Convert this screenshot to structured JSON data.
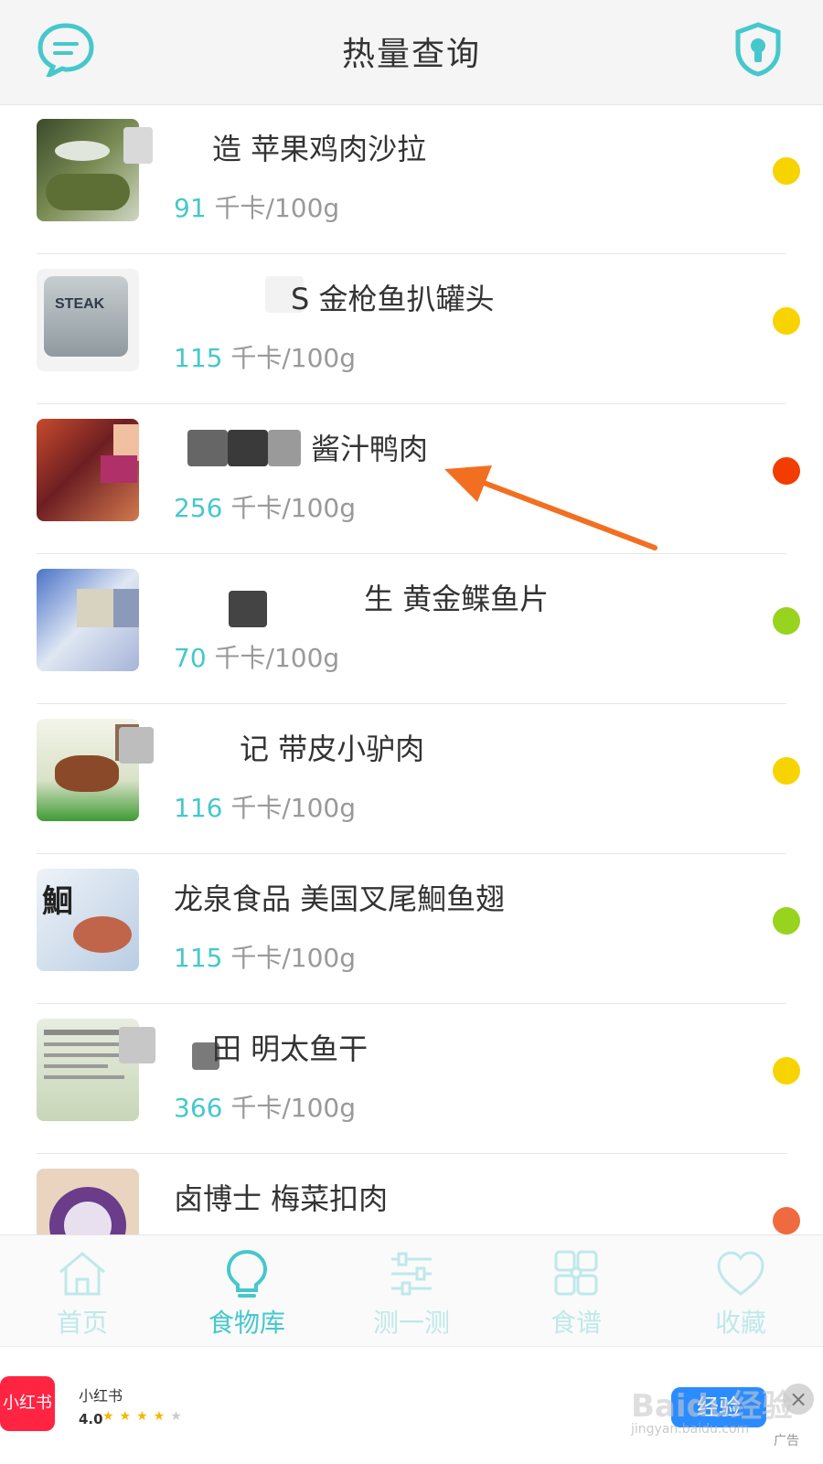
{
  "header": {
    "title": "热量查询",
    "left_icon": "chat-bubble-icon",
    "right_icon": "lock-shield-icon"
  },
  "colors": {
    "accent": "#45c8cc",
    "dot_yellow": "#f7d400",
    "dot_red": "#f23c00",
    "dot_green": "#98d31f"
  },
  "foods": [
    {
      "name": "造 苹果鸡肉沙拉",
      "calories": "91",
      "unit": "千卡/100g",
      "level": "yellow"
    },
    {
      "name": "S 金枪鱼扒罐头",
      "calories": "115",
      "unit": "千卡/100g",
      "level": "yellow"
    },
    {
      "name": "酱汁鸭肉",
      "calories": "256",
      "unit": "千卡/100g",
      "level": "red"
    },
    {
      "name": "生 黄金鲽鱼片",
      "calories": "70",
      "unit": "千卡/100g",
      "level": "green"
    },
    {
      "name": "记 带皮小驴肉",
      "calories": "116",
      "unit": "千卡/100g",
      "level": "yellow"
    },
    {
      "name": "龙泉食品 美国叉尾鮰鱼翅",
      "calories": "115",
      "unit": "千卡/100g",
      "level": "green"
    },
    {
      "name": "田 明太鱼干",
      "calories": "366",
      "unit": "千卡/100g",
      "level": "yellow"
    },
    {
      "name": "卤博士 梅菜扣肉",
      "calories": "",
      "unit": "",
      "level": "red"
    }
  ],
  "nav": [
    {
      "label": "首页",
      "icon": "home-icon",
      "active": false
    },
    {
      "label": "食物库",
      "icon": "lightbulb-icon",
      "active": true
    },
    {
      "label": "测一测",
      "icon": "sliders-icon",
      "active": false
    },
    {
      "label": "食谱",
      "icon": "grid-icon",
      "active": false
    },
    {
      "label": "收藏",
      "icon": "heart-icon",
      "active": false
    }
  ],
  "ad": {
    "logo_text": "小红书",
    "app_name": "小红书",
    "rating": "4.0",
    "button_label": "经验",
    "close_label": "×",
    "ad_tag": "广告"
  },
  "watermark": {
    "brand": "Baidu经验",
    "url": "jingyan.baidu.com"
  }
}
